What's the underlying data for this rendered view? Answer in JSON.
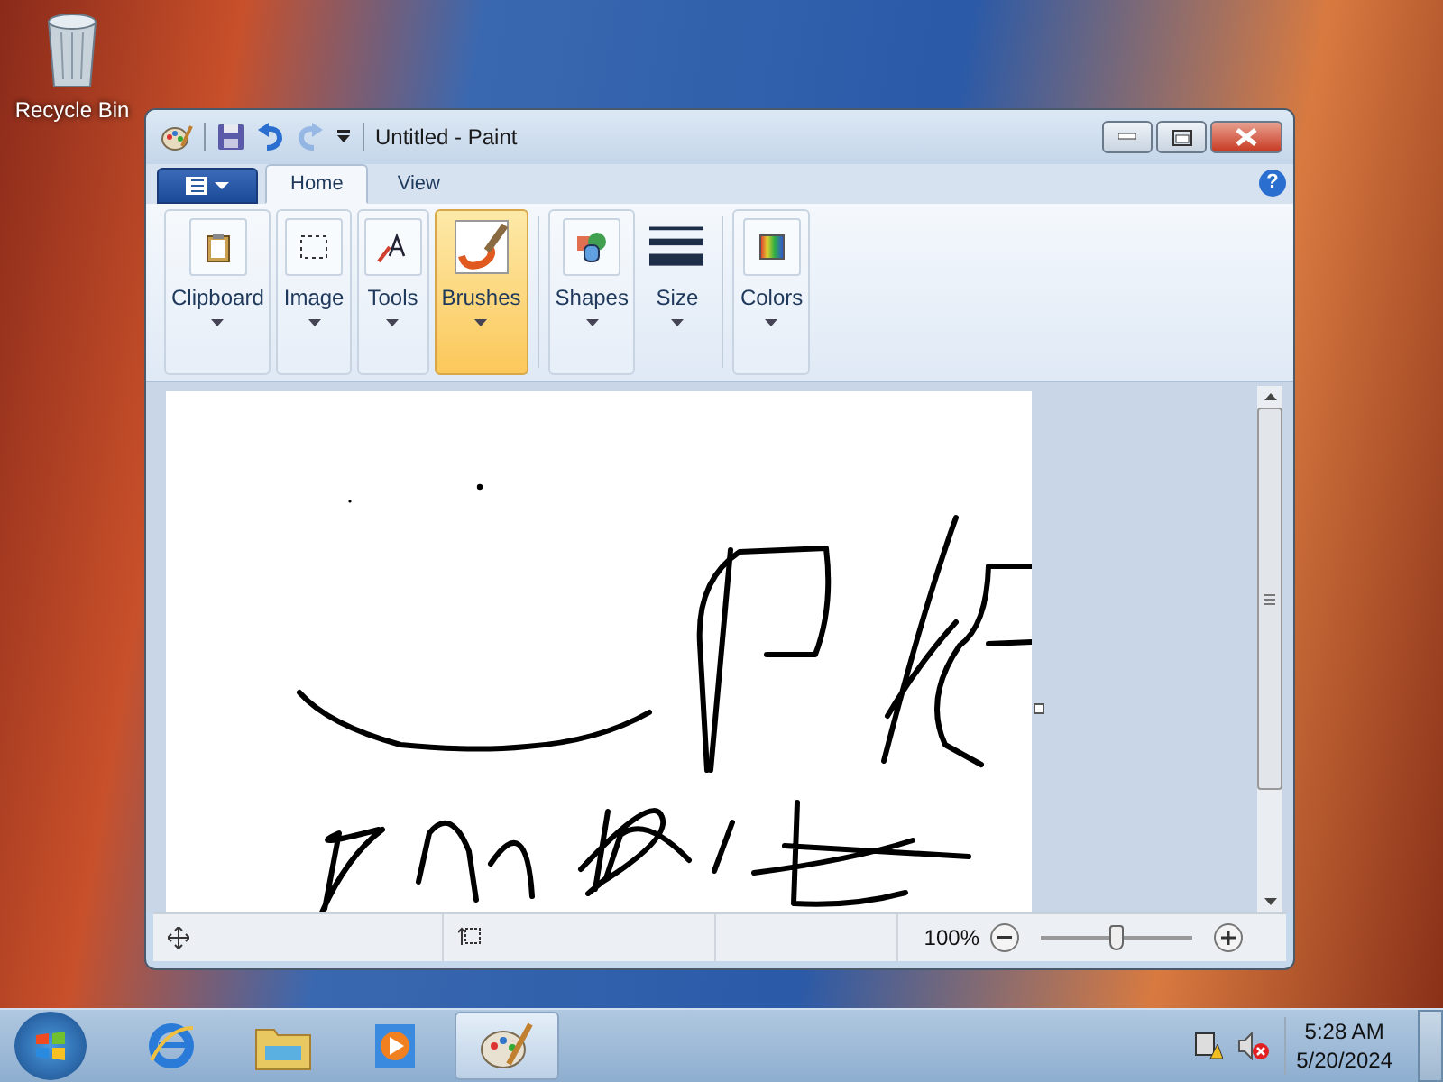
{
  "desktop": {
    "icons": [
      {
        "label": "Recycle Bin"
      }
    ]
  },
  "window": {
    "title": "Untitled - Paint",
    "quick_access": [
      {
        "kind": "save",
        "disabled": false
      },
      {
        "kind": "undo",
        "disabled": false
      },
      {
        "kind": "redo",
        "disabled": true
      }
    ]
  },
  "help": "?",
  "tabs": [
    {
      "label": "Home",
      "selected": true
    },
    {
      "label": "View",
      "selected": false
    }
  ],
  "ribbon": {
    "groups": [
      {
        "label": "Clipboard",
        "selected": false
      },
      {
        "label": "Image",
        "selected": false
      },
      {
        "label": "Tools",
        "selected": false
      },
      {
        "label": "Brushes",
        "selected": true
      },
      {
        "label": "Shapes",
        "selected": false
      },
      {
        "label": "Size",
        "selected": false
      },
      {
        "label": "Colors",
        "selected": false
      }
    ]
  },
  "status_bar": {
    "zoom": "100%",
    "level": 0.5
  },
  "taskbar": {
    "items": [
      {
        "kind": "browser",
        "selected": false
      },
      {
        "kind": "folder",
        "selected": false
      },
      {
        "kind": "media",
        "selected": false
      },
      {
        "kind": "paint",
        "selected": true
      }
    ],
    "time": "5:28 AM",
    "date": "5/20/2024"
  }
}
